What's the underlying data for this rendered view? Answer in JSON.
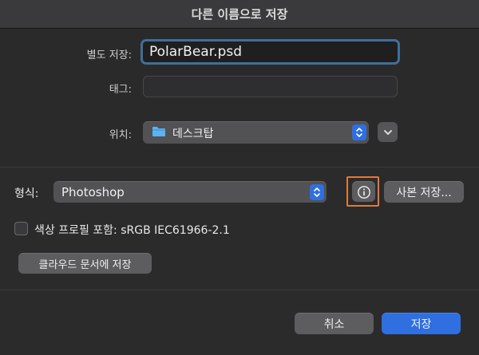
{
  "dialog": {
    "title": "다른 이름으로 저장"
  },
  "save_as": {
    "label": "별도 저장:",
    "value": "PolarBear.psd"
  },
  "tags": {
    "label": "태그:",
    "value": ""
  },
  "location": {
    "label": "위치:",
    "value": "데스크탑",
    "icon": "folder-icon"
  },
  "format": {
    "label": "형식:",
    "value": "Photoshop"
  },
  "info_button": {
    "icon": "info-icon",
    "highlight_color": "#e07a3c"
  },
  "save_copy_button": {
    "label": "사본 저장..."
  },
  "color_profile": {
    "label": "색상 프로필 포함: sRGB IEC61966-2.1",
    "checked": false
  },
  "cloud_button": {
    "label": "클라우드 문서에 저장"
  },
  "actions": {
    "cancel": "취소",
    "save": "저장"
  },
  "colors": {
    "accent": "#2f6fe0",
    "background": "#2b2b2c",
    "field_focus": "#3f6f9a"
  }
}
